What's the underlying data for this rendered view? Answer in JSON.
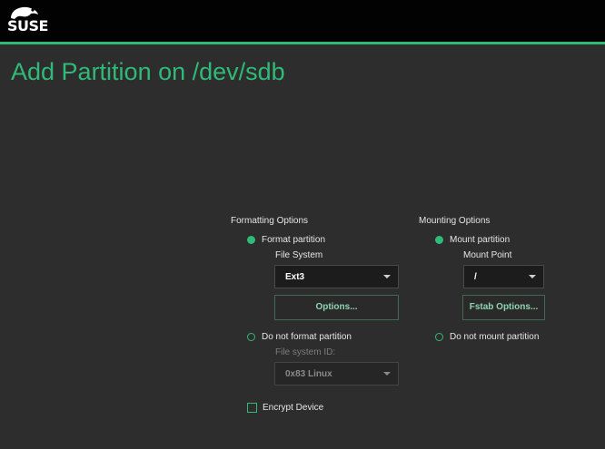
{
  "header": {
    "logo_text": "SUSE",
    "accent_color": "#30ba78"
  },
  "page": {
    "title": "Add Partition on /dev/sdb"
  },
  "formatting": {
    "section_label": "Formatting Options",
    "format_option_label": "Format partition",
    "format_selected": true,
    "file_system_label": "File System",
    "file_system_value": "Ext3",
    "options_button": "Options...",
    "no_format_option_label": "Do not format partition",
    "file_system_id_label": "File system ID:",
    "file_system_id_value": "0x83 Linux",
    "encrypt_label": "Encrypt Device",
    "encrypt_checked": false
  },
  "mounting": {
    "section_label": "Mounting Options",
    "mount_option_label": "Mount partition",
    "mount_selected": true,
    "mount_point_label": "Mount Point",
    "mount_point_value": "/",
    "fstab_button": "Fstab Options...",
    "no_mount_option_label": "Do not mount partition"
  }
}
